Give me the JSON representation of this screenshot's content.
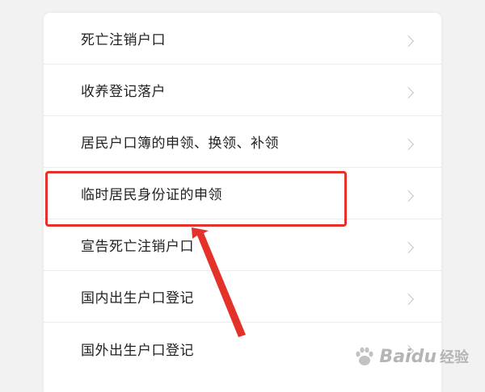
{
  "menu": {
    "items": [
      {
        "label": "死亡注销户口"
      },
      {
        "label": "收养登记落户"
      },
      {
        "label": "居民户口簿的申领、换领、补领"
      },
      {
        "label": "临时居民身份证的申领"
      },
      {
        "label": "宣告死亡注销户口"
      },
      {
        "label": "国内出生户口登记"
      },
      {
        "label": "国外出生户口登记"
      }
    ]
  },
  "annotation": {
    "color": "#e4312a"
  },
  "watermark": {
    "brand": "Baidu",
    "sub": "经验"
  }
}
